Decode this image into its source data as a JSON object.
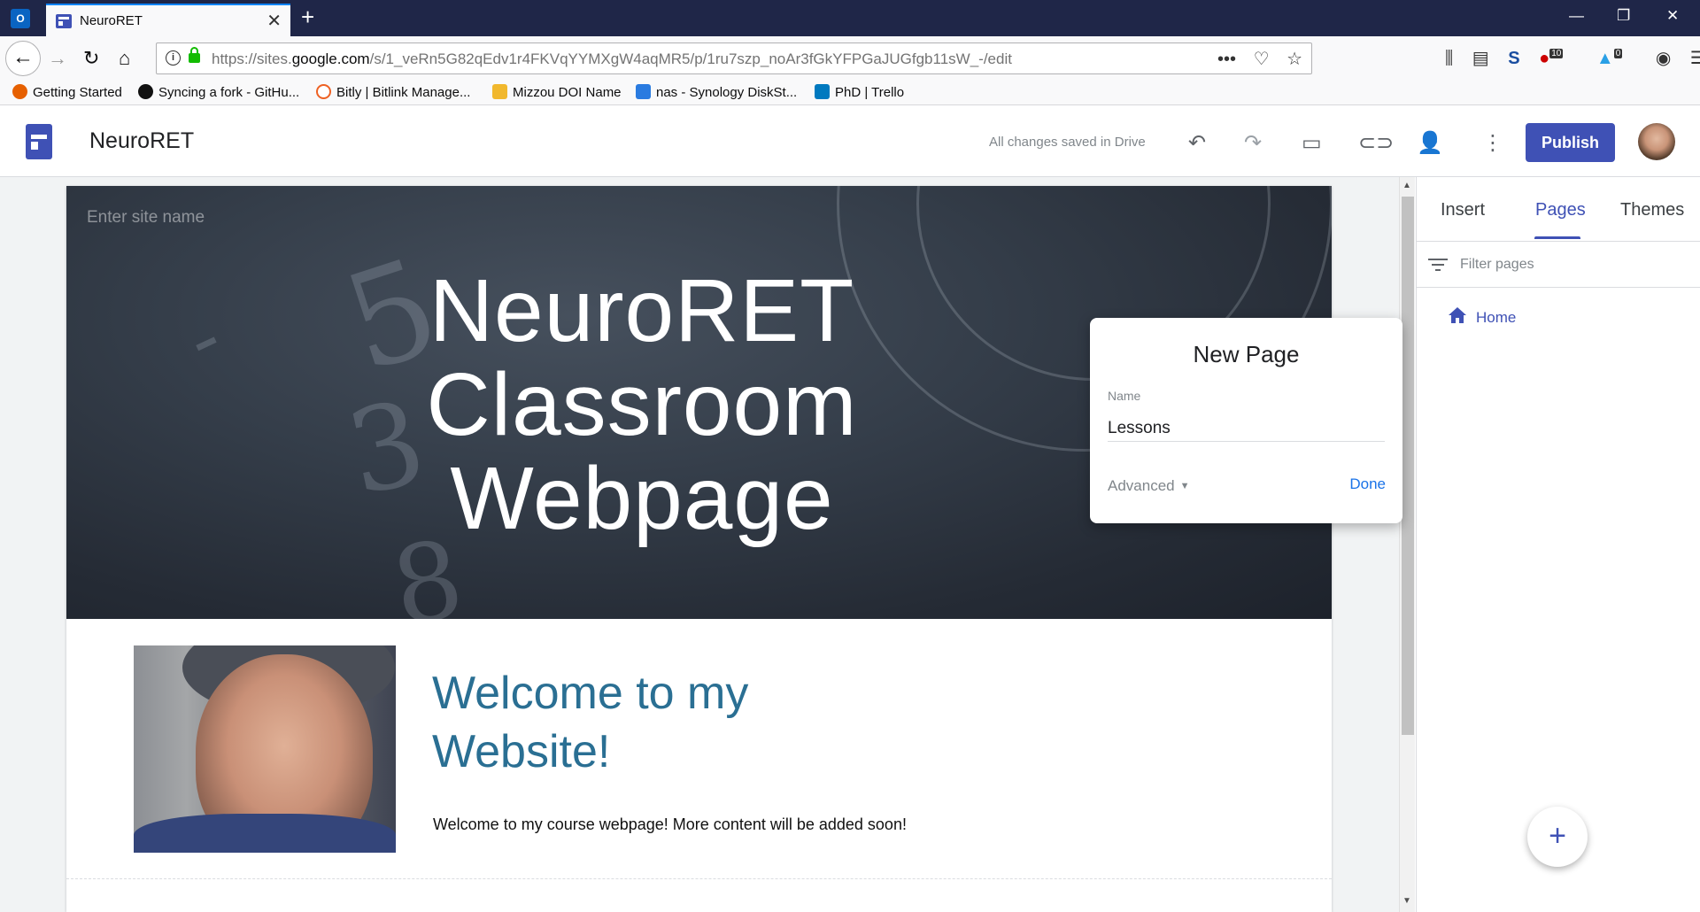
{
  "browser": {
    "tab_title": "NeuroRET",
    "url_prefix": "https://sites.",
    "url_domain": "google.com",
    "url_path": "/s/1_veRn5G82qEdv1r4FKVqYYMXgW4aqMR5/p/1ru7szp_noAr3fGkYFPGaJUGfgb11sW_-/edit",
    "badge_adblock": "10",
    "badge_notify": "0",
    "bookmarks": [
      {
        "label": "Getting Started"
      },
      {
        "label": "Syncing a fork - GitHu..."
      },
      {
        "label": "Bitly | Bitlink Manage..."
      },
      {
        "label": "Mizzou DOI Name"
      },
      {
        "label": "nas - Synology DiskSt..."
      },
      {
        "label": "PhD | Trello"
      }
    ]
  },
  "app": {
    "site_title": "NeuroRET",
    "save_status": "All changes saved in Drive",
    "publish_label": "Publish"
  },
  "page": {
    "site_name_placeholder": "Enter site name",
    "hero_title": "NeuroRET Classroom Webpage",
    "welcome_heading": "Welcome to my Website!",
    "welcome_text": "Welcome to my course webpage! More content will be added  soon!"
  },
  "dialog": {
    "title": "New Page",
    "name_label": "Name",
    "name_value": "Lessons",
    "advanced_label": "Advanced",
    "done_label": "Done"
  },
  "panel": {
    "tabs": [
      {
        "label": "Insert"
      },
      {
        "label": "Pages"
      },
      {
        "label": "Themes"
      }
    ],
    "active_tab": "Pages",
    "filter_placeholder": "Filter pages",
    "pages": [
      {
        "label": "Home"
      }
    ],
    "fab_label": "+"
  },
  "colors": {
    "accent": "#3f51b5",
    "link": "#1a73e8",
    "heading": "#2a6f93"
  }
}
